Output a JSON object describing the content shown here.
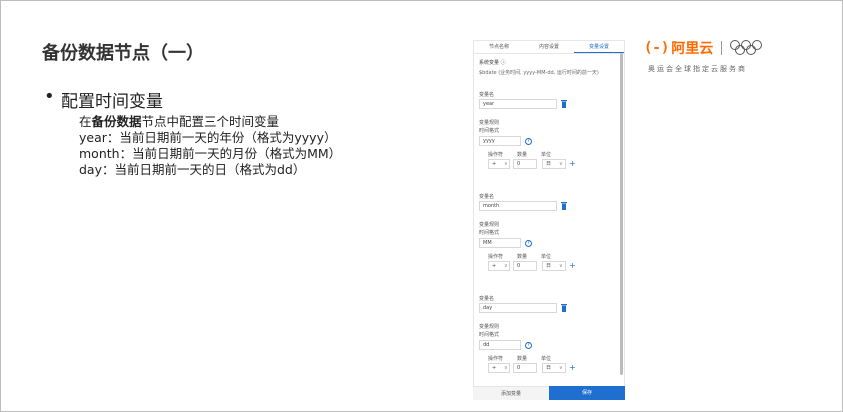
{
  "slide": {
    "title": "备份数据节点（一）",
    "bullet_heading": "配置时间变量",
    "line1_prefix": "在",
    "line1_bold": "备份数据",
    "line1_suffix": "节点中配置三个时间变量",
    "line2": "year：当前日期前一天的年份（格式为yyyy）",
    "line3": "month：当前日期前一天的月份（格式为MM）",
    "line4": "day：当前日期前一天的日（格式为dd）"
  },
  "logo": {
    "bracket": "(-)",
    "name": "阿里云",
    "subtitle": "奥运会全球指定云服务商",
    "ring_colors": [
      "#555555",
      "#555555",
      "#555555",
      "#555555",
      "#555555"
    ]
  },
  "panel": {
    "tabs": [
      "节点名称",
      "内容设置",
      "变量设置"
    ],
    "active_tab": 2,
    "system_var_label": "系统变量 ⓘ",
    "system_var_hint": "$bdate (业务时间, yyyy-MM-dd, 运行时间的前一天)",
    "variables": [
      {
        "name_label": "变量名",
        "name_value": "year",
        "rule_label": "变量规则",
        "format_label": "时间格式",
        "format_value": "yyyy",
        "op_label": "操作符",
        "num_label": "数量",
        "unit_label": "单位",
        "op_value": "+",
        "num_value": "0",
        "unit_value": "日"
      },
      {
        "name_label": "变量名",
        "name_value": "month",
        "rule_label": "变量规则",
        "format_label": "时间格式",
        "format_value": "MM",
        "op_label": "操作符",
        "num_label": "数量",
        "unit_label": "单位",
        "op_value": "+",
        "num_value": "0",
        "unit_value": "日"
      },
      {
        "name_label": "变量名",
        "name_value": "day",
        "rule_label": "变量规则",
        "format_label": "时间格式",
        "format_value": "dd",
        "op_label": "操作符",
        "num_label": "数量",
        "unit_label": "单位",
        "op_value": "+",
        "num_value": "0",
        "unit_value": "日"
      }
    ],
    "footer_left": "添加变量",
    "footer_right": "保存",
    "accent_color": "#1f6fd1"
  }
}
